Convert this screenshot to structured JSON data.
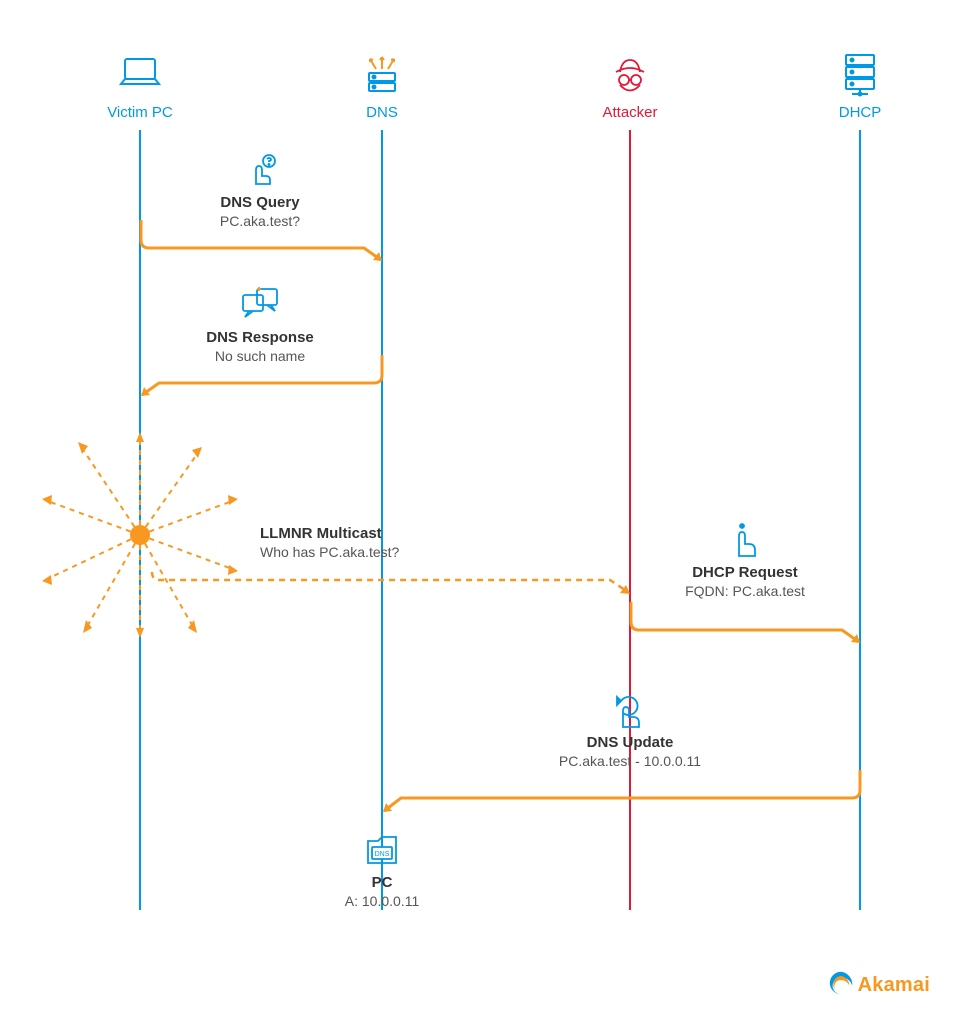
{
  "actors": {
    "victim": {
      "label": "Victim PC"
    },
    "dns": {
      "label": "DNS"
    },
    "attacker": {
      "label": "Attacker"
    },
    "dhcp": {
      "label": "DHCP"
    }
  },
  "messages": {
    "dnsQuery": {
      "title": "DNS Query",
      "sub": "PC.aka.test?"
    },
    "dnsResponse": {
      "title": "DNS Response",
      "sub": "No such name"
    },
    "llmnr": {
      "title": "LLMNR Multicast",
      "sub": "Who has PC.aka.test?"
    },
    "dhcpReq": {
      "title": "DHCP Request",
      "sub": "FQDN: PC.aka.test"
    },
    "dnsUpdate": {
      "title": "DNS Update",
      "sub": "PC.aka.test - 10.0.0.11"
    }
  },
  "result": {
    "title": "PC",
    "sub": "A: 10.0.0.11"
  },
  "brand": {
    "name": "Akamai"
  },
  "colors": {
    "blue": "#0099e5",
    "red": "#e31837",
    "orange": "#f89820"
  }
}
